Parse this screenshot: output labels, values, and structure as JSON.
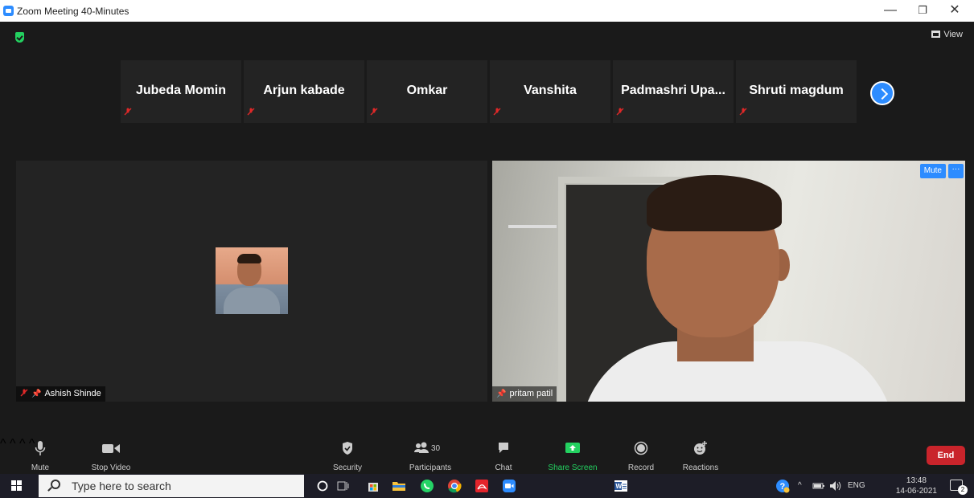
{
  "window": {
    "title": "Zoom Meeting 40-Minutes",
    "minimize": "—",
    "maximize": "❐",
    "close": "✕"
  },
  "meeting": {
    "view_label": "View",
    "thumbnails": [
      {
        "name": "Jubeda Momin",
        "muted": true
      },
      {
        "name": "Arjun kabade",
        "muted": true
      },
      {
        "name": "Omkar",
        "muted": true
      },
      {
        "name": "Vanshita",
        "muted": true
      },
      {
        "name": "Padmashri  Upa...",
        "muted": true
      },
      {
        "name": "Shruti magdum",
        "muted": true
      }
    ],
    "tile_left": {
      "name": "Ashish Shinde",
      "muted": true,
      "pinned": true
    },
    "tile_right": {
      "name": "pritam patil",
      "pinned": true,
      "mute_label": "Mute",
      "more_label": "···"
    }
  },
  "toolbar": {
    "mute": "Mute",
    "stop_video": "Stop Video",
    "security": "Security",
    "participants": "Participants",
    "participant_count": "30",
    "chat": "Chat",
    "share_screen": "Share Screen",
    "record": "Record",
    "reactions": "Reactions",
    "end": "End"
  },
  "taskbar": {
    "search_placeholder": "Type here to search",
    "language": "ENG",
    "time": "13:48",
    "date": "14-06-2021",
    "notification_count": "2"
  },
  "colors": {
    "accent": "#2d8cff",
    "end": "#c9242b",
    "share": "#23d160",
    "muted_mic": "#e02828"
  }
}
